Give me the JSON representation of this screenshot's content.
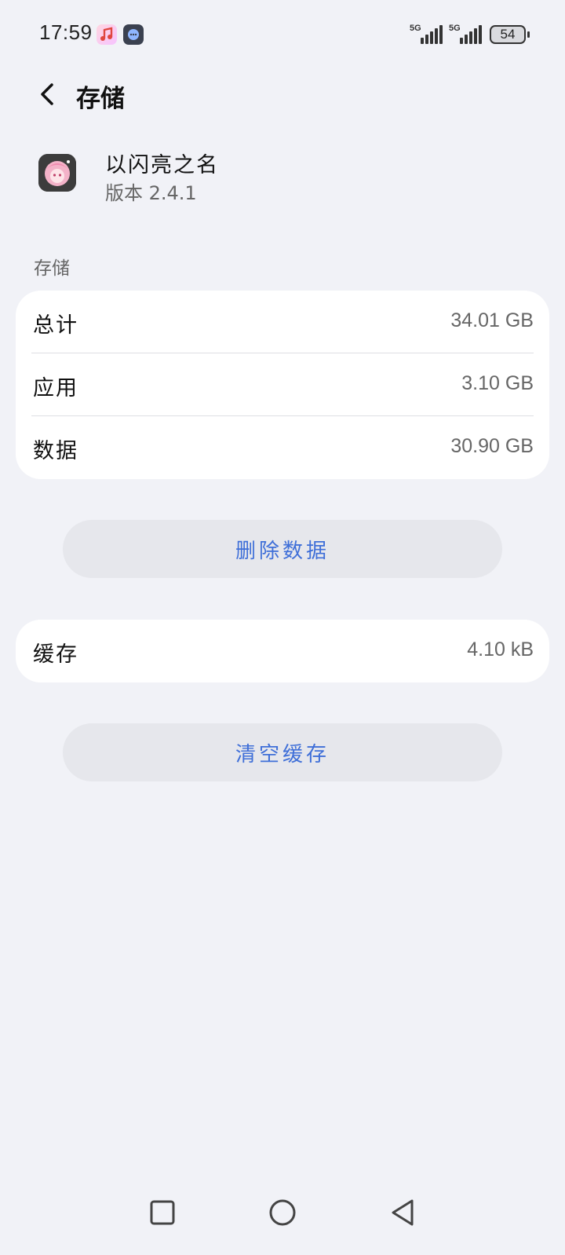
{
  "status_bar": {
    "time": "17:59",
    "network_1": "5G",
    "network_2": "5G",
    "battery": "54",
    "icons": [
      "music-app-icon",
      "chat-app-icon",
      "signal-icon",
      "signal-icon",
      "battery-icon"
    ]
  },
  "header": {
    "title": "存储",
    "back_icon": "chevron-left-icon"
  },
  "app": {
    "name": "以闪亮之名",
    "version": "版本 2.4.1"
  },
  "storage": {
    "section_label": "存储",
    "rows": [
      {
        "label": "总计",
        "value": "34.01 GB"
      },
      {
        "label": "应用",
        "value": "3.10 GB"
      },
      {
        "label": "数据",
        "value": "30.90 GB"
      }
    ],
    "delete_button": "删除数据"
  },
  "cache": {
    "label": "缓存",
    "value": "4.10 kB",
    "clear_button": "清空缓存"
  },
  "nav_bar": {
    "icons": [
      "square-icon",
      "circle-icon",
      "triangle-back-icon"
    ]
  },
  "colors": {
    "background": "#f1f2f7",
    "card": "#ffffff",
    "accent": "#3f6fd8",
    "button_bg": "#e6e7ec"
  }
}
